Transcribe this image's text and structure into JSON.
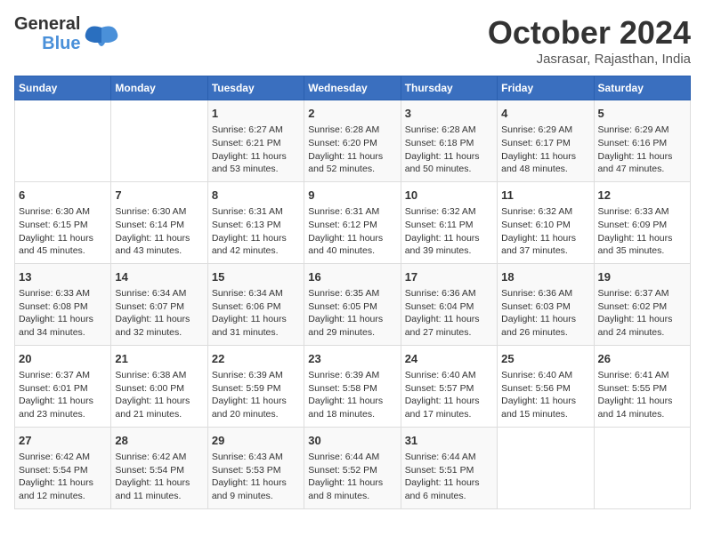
{
  "logo": {
    "line1": "General",
    "line2": "Blue"
  },
  "header": {
    "month": "October 2024",
    "location": "Jasrasar, Rajasthan, India"
  },
  "weekdays": [
    "Sunday",
    "Monday",
    "Tuesday",
    "Wednesday",
    "Thursday",
    "Friday",
    "Saturday"
  ],
  "weeks": [
    [
      {
        "day": "",
        "info": ""
      },
      {
        "day": "",
        "info": ""
      },
      {
        "day": "1",
        "info": "Sunrise: 6:27 AM\nSunset: 6:21 PM\nDaylight: 11 hours and 53 minutes."
      },
      {
        "day": "2",
        "info": "Sunrise: 6:28 AM\nSunset: 6:20 PM\nDaylight: 11 hours and 52 minutes."
      },
      {
        "day": "3",
        "info": "Sunrise: 6:28 AM\nSunset: 6:18 PM\nDaylight: 11 hours and 50 minutes."
      },
      {
        "day": "4",
        "info": "Sunrise: 6:29 AM\nSunset: 6:17 PM\nDaylight: 11 hours and 48 minutes."
      },
      {
        "day": "5",
        "info": "Sunrise: 6:29 AM\nSunset: 6:16 PM\nDaylight: 11 hours and 47 minutes."
      }
    ],
    [
      {
        "day": "6",
        "info": "Sunrise: 6:30 AM\nSunset: 6:15 PM\nDaylight: 11 hours and 45 minutes."
      },
      {
        "day": "7",
        "info": "Sunrise: 6:30 AM\nSunset: 6:14 PM\nDaylight: 11 hours and 43 minutes."
      },
      {
        "day": "8",
        "info": "Sunrise: 6:31 AM\nSunset: 6:13 PM\nDaylight: 11 hours and 42 minutes."
      },
      {
        "day": "9",
        "info": "Sunrise: 6:31 AM\nSunset: 6:12 PM\nDaylight: 11 hours and 40 minutes."
      },
      {
        "day": "10",
        "info": "Sunrise: 6:32 AM\nSunset: 6:11 PM\nDaylight: 11 hours and 39 minutes."
      },
      {
        "day": "11",
        "info": "Sunrise: 6:32 AM\nSunset: 6:10 PM\nDaylight: 11 hours and 37 minutes."
      },
      {
        "day": "12",
        "info": "Sunrise: 6:33 AM\nSunset: 6:09 PM\nDaylight: 11 hours and 35 minutes."
      }
    ],
    [
      {
        "day": "13",
        "info": "Sunrise: 6:33 AM\nSunset: 6:08 PM\nDaylight: 11 hours and 34 minutes."
      },
      {
        "day": "14",
        "info": "Sunrise: 6:34 AM\nSunset: 6:07 PM\nDaylight: 11 hours and 32 minutes."
      },
      {
        "day": "15",
        "info": "Sunrise: 6:34 AM\nSunset: 6:06 PM\nDaylight: 11 hours and 31 minutes."
      },
      {
        "day": "16",
        "info": "Sunrise: 6:35 AM\nSunset: 6:05 PM\nDaylight: 11 hours and 29 minutes."
      },
      {
        "day": "17",
        "info": "Sunrise: 6:36 AM\nSunset: 6:04 PM\nDaylight: 11 hours and 27 minutes."
      },
      {
        "day": "18",
        "info": "Sunrise: 6:36 AM\nSunset: 6:03 PM\nDaylight: 11 hours and 26 minutes."
      },
      {
        "day": "19",
        "info": "Sunrise: 6:37 AM\nSunset: 6:02 PM\nDaylight: 11 hours and 24 minutes."
      }
    ],
    [
      {
        "day": "20",
        "info": "Sunrise: 6:37 AM\nSunset: 6:01 PM\nDaylight: 11 hours and 23 minutes."
      },
      {
        "day": "21",
        "info": "Sunrise: 6:38 AM\nSunset: 6:00 PM\nDaylight: 11 hours and 21 minutes."
      },
      {
        "day": "22",
        "info": "Sunrise: 6:39 AM\nSunset: 5:59 PM\nDaylight: 11 hours and 20 minutes."
      },
      {
        "day": "23",
        "info": "Sunrise: 6:39 AM\nSunset: 5:58 PM\nDaylight: 11 hours and 18 minutes."
      },
      {
        "day": "24",
        "info": "Sunrise: 6:40 AM\nSunset: 5:57 PM\nDaylight: 11 hours and 17 minutes."
      },
      {
        "day": "25",
        "info": "Sunrise: 6:40 AM\nSunset: 5:56 PM\nDaylight: 11 hours and 15 minutes."
      },
      {
        "day": "26",
        "info": "Sunrise: 6:41 AM\nSunset: 5:55 PM\nDaylight: 11 hours and 14 minutes."
      }
    ],
    [
      {
        "day": "27",
        "info": "Sunrise: 6:42 AM\nSunset: 5:54 PM\nDaylight: 11 hours and 12 minutes."
      },
      {
        "day": "28",
        "info": "Sunrise: 6:42 AM\nSunset: 5:54 PM\nDaylight: 11 hours and 11 minutes."
      },
      {
        "day": "29",
        "info": "Sunrise: 6:43 AM\nSunset: 5:53 PM\nDaylight: 11 hours and 9 minutes."
      },
      {
        "day": "30",
        "info": "Sunrise: 6:44 AM\nSunset: 5:52 PM\nDaylight: 11 hours and 8 minutes."
      },
      {
        "day": "31",
        "info": "Sunrise: 6:44 AM\nSunset: 5:51 PM\nDaylight: 11 hours and 6 minutes."
      },
      {
        "day": "",
        "info": ""
      },
      {
        "day": "",
        "info": ""
      }
    ]
  ]
}
